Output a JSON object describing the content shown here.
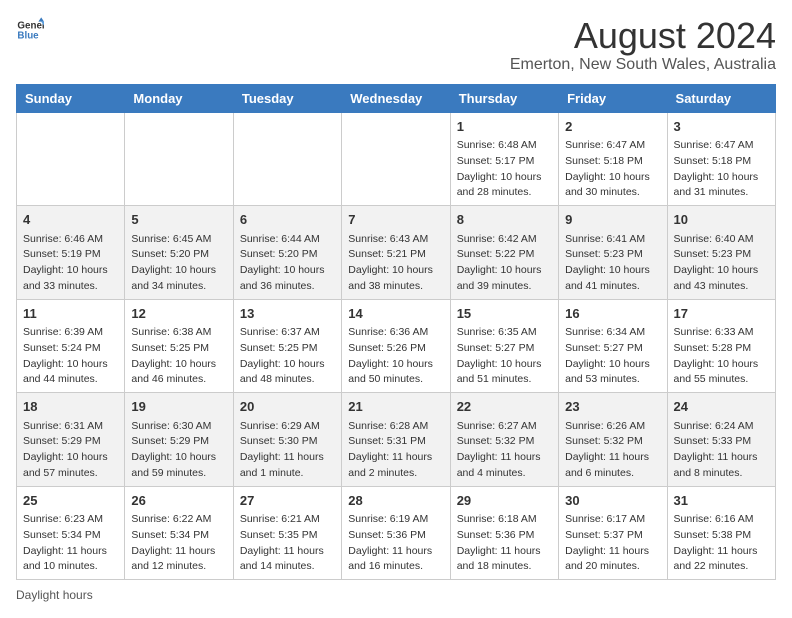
{
  "header": {
    "logo_general": "General",
    "logo_blue": "Blue",
    "title": "August 2024",
    "subtitle": "Emerton, New South Wales, Australia"
  },
  "calendar": {
    "days_of_week": [
      "Sunday",
      "Monday",
      "Tuesday",
      "Wednesday",
      "Thursday",
      "Friday",
      "Saturday"
    ],
    "weeks": [
      [
        {
          "day": "",
          "info": ""
        },
        {
          "day": "",
          "info": ""
        },
        {
          "day": "",
          "info": ""
        },
        {
          "day": "",
          "info": ""
        },
        {
          "day": "1",
          "info": "Sunrise: 6:48 AM\nSunset: 5:17 PM\nDaylight: 10 hours and 28 minutes."
        },
        {
          "day": "2",
          "info": "Sunrise: 6:47 AM\nSunset: 5:18 PM\nDaylight: 10 hours and 30 minutes."
        },
        {
          "day": "3",
          "info": "Sunrise: 6:47 AM\nSunset: 5:18 PM\nDaylight: 10 hours and 31 minutes."
        }
      ],
      [
        {
          "day": "4",
          "info": "Sunrise: 6:46 AM\nSunset: 5:19 PM\nDaylight: 10 hours and 33 minutes."
        },
        {
          "day": "5",
          "info": "Sunrise: 6:45 AM\nSunset: 5:20 PM\nDaylight: 10 hours and 34 minutes."
        },
        {
          "day": "6",
          "info": "Sunrise: 6:44 AM\nSunset: 5:20 PM\nDaylight: 10 hours and 36 minutes."
        },
        {
          "day": "7",
          "info": "Sunrise: 6:43 AM\nSunset: 5:21 PM\nDaylight: 10 hours and 38 minutes."
        },
        {
          "day": "8",
          "info": "Sunrise: 6:42 AM\nSunset: 5:22 PM\nDaylight: 10 hours and 39 minutes."
        },
        {
          "day": "9",
          "info": "Sunrise: 6:41 AM\nSunset: 5:23 PM\nDaylight: 10 hours and 41 minutes."
        },
        {
          "day": "10",
          "info": "Sunrise: 6:40 AM\nSunset: 5:23 PM\nDaylight: 10 hours and 43 minutes."
        }
      ],
      [
        {
          "day": "11",
          "info": "Sunrise: 6:39 AM\nSunset: 5:24 PM\nDaylight: 10 hours and 44 minutes."
        },
        {
          "day": "12",
          "info": "Sunrise: 6:38 AM\nSunset: 5:25 PM\nDaylight: 10 hours and 46 minutes."
        },
        {
          "day": "13",
          "info": "Sunrise: 6:37 AM\nSunset: 5:25 PM\nDaylight: 10 hours and 48 minutes."
        },
        {
          "day": "14",
          "info": "Sunrise: 6:36 AM\nSunset: 5:26 PM\nDaylight: 10 hours and 50 minutes."
        },
        {
          "day": "15",
          "info": "Sunrise: 6:35 AM\nSunset: 5:27 PM\nDaylight: 10 hours and 51 minutes."
        },
        {
          "day": "16",
          "info": "Sunrise: 6:34 AM\nSunset: 5:27 PM\nDaylight: 10 hours and 53 minutes."
        },
        {
          "day": "17",
          "info": "Sunrise: 6:33 AM\nSunset: 5:28 PM\nDaylight: 10 hours and 55 minutes."
        }
      ],
      [
        {
          "day": "18",
          "info": "Sunrise: 6:31 AM\nSunset: 5:29 PM\nDaylight: 10 hours and 57 minutes."
        },
        {
          "day": "19",
          "info": "Sunrise: 6:30 AM\nSunset: 5:29 PM\nDaylight: 10 hours and 59 minutes."
        },
        {
          "day": "20",
          "info": "Sunrise: 6:29 AM\nSunset: 5:30 PM\nDaylight: 11 hours and 1 minute."
        },
        {
          "day": "21",
          "info": "Sunrise: 6:28 AM\nSunset: 5:31 PM\nDaylight: 11 hours and 2 minutes."
        },
        {
          "day": "22",
          "info": "Sunrise: 6:27 AM\nSunset: 5:32 PM\nDaylight: 11 hours and 4 minutes."
        },
        {
          "day": "23",
          "info": "Sunrise: 6:26 AM\nSunset: 5:32 PM\nDaylight: 11 hours and 6 minutes."
        },
        {
          "day": "24",
          "info": "Sunrise: 6:24 AM\nSunset: 5:33 PM\nDaylight: 11 hours and 8 minutes."
        }
      ],
      [
        {
          "day": "25",
          "info": "Sunrise: 6:23 AM\nSunset: 5:34 PM\nDaylight: 11 hours and 10 minutes."
        },
        {
          "day": "26",
          "info": "Sunrise: 6:22 AM\nSunset: 5:34 PM\nDaylight: 11 hours and 12 minutes."
        },
        {
          "day": "27",
          "info": "Sunrise: 6:21 AM\nSunset: 5:35 PM\nDaylight: 11 hours and 14 minutes."
        },
        {
          "day": "28",
          "info": "Sunrise: 6:19 AM\nSunset: 5:36 PM\nDaylight: 11 hours and 16 minutes."
        },
        {
          "day": "29",
          "info": "Sunrise: 6:18 AM\nSunset: 5:36 PM\nDaylight: 11 hours and 18 minutes."
        },
        {
          "day": "30",
          "info": "Sunrise: 6:17 AM\nSunset: 5:37 PM\nDaylight: 11 hours and 20 minutes."
        },
        {
          "day": "31",
          "info": "Sunrise: 6:16 AM\nSunset: 5:38 PM\nDaylight: 11 hours and 22 minutes."
        }
      ]
    ]
  },
  "legend": {
    "label": "Daylight hours"
  }
}
